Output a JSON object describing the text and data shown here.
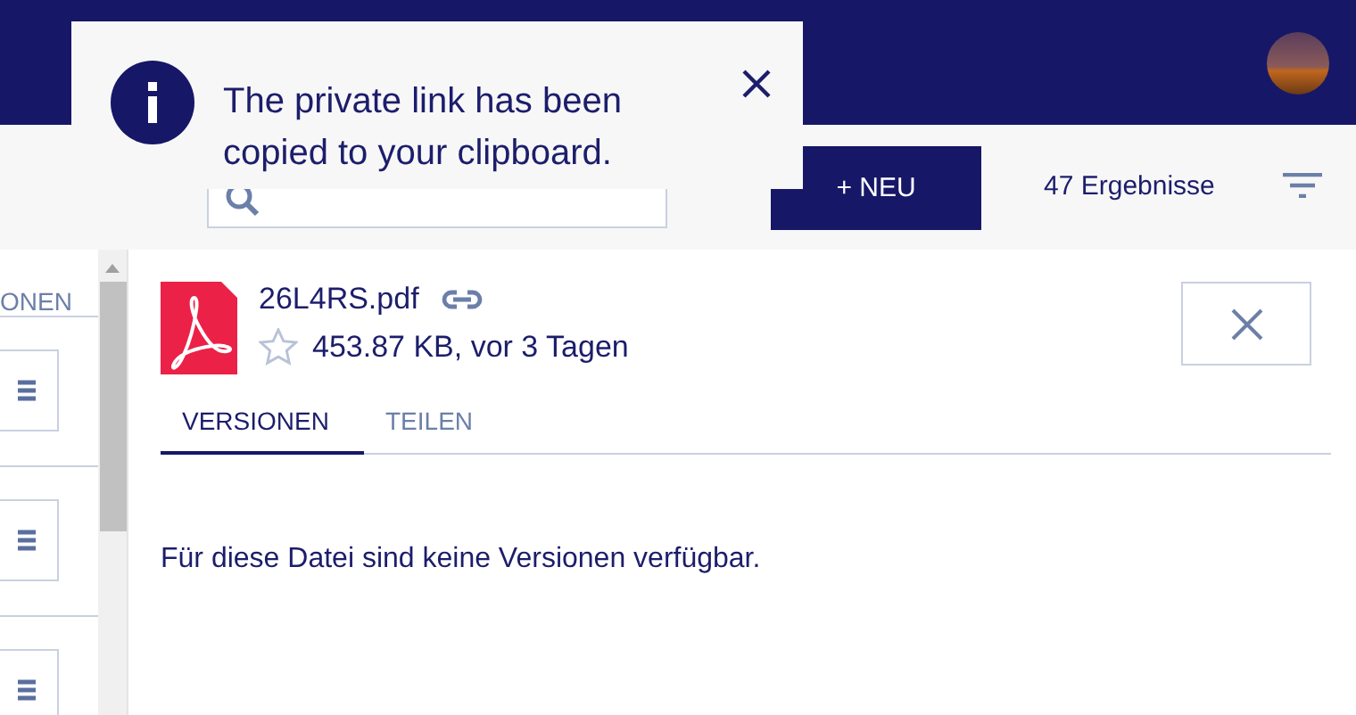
{
  "toast": {
    "kind": "info",
    "message": "The private link has been copied to your clipboard."
  },
  "toolbar": {
    "new_button": "+ NEU",
    "result_count": "47 Ergebnisse"
  },
  "side_list": {
    "tab_label": "ONEN"
  },
  "file": {
    "name": "26L4RS.pdf",
    "meta": "453.87 KB, vor 3 Tagen",
    "starred": false
  },
  "tabs": [
    {
      "label": "VERSIONEN",
      "selected": true
    },
    {
      "label": "TEILEN",
      "selected": false
    }
  ],
  "empty_message": "Für diese Datei sind keine Versionen verfügbar."
}
